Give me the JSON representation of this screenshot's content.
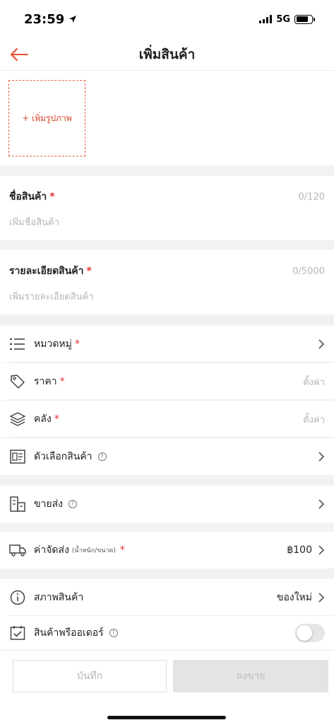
{
  "status_bar": {
    "time": "23:59",
    "network": "5G"
  },
  "header": {
    "title": "เพิ่มสินค้า"
  },
  "photo": {
    "add_label": "+ เพิ่มรูปภาพ"
  },
  "product_name": {
    "label": "ชื่อสินค้า",
    "required": "*",
    "counter": "0/120",
    "placeholder": "เพิ่มชื่อสินค้า"
  },
  "product_description": {
    "label": "รายละเอียดสินค้า",
    "required": "*",
    "counter": "0/5000",
    "placeholder": "เพิ่มรายละเอียดสินค้า"
  },
  "category": {
    "label": "หมวดหมู่",
    "required": "*"
  },
  "price": {
    "label": "ราคา",
    "required": "*",
    "hint": "ตั้งค่า"
  },
  "stock": {
    "label": "คลัง",
    "required": "*",
    "hint": "ตั้งค่า"
  },
  "variations": {
    "label": "ตัวเลือกสินค้า",
    "help": "?"
  },
  "wholesale": {
    "label": "ขายส่ง",
    "help": "?"
  },
  "shipping": {
    "label": "ค่าจัดส่ง",
    "sublabel": "(น้ำหนัก/ขนาด)",
    "required": "*",
    "value": "฿100"
  },
  "condition": {
    "label": "สภาพสินค้า",
    "value": "ของใหม่"
  },
  "preorder": {
    "label": "สินค้าพรีออเดอร์",
    "help": "?",
    "enabled": false
  },
  "actions": {
    "save_label": "บันทึก",
    "publish_label": "ลงขาย"
  },
  "colors": {
    "accent": "#EE4D2D",
    "required": "#E4312D",
    "placeholder": "#B6B6B6"
  }
}
